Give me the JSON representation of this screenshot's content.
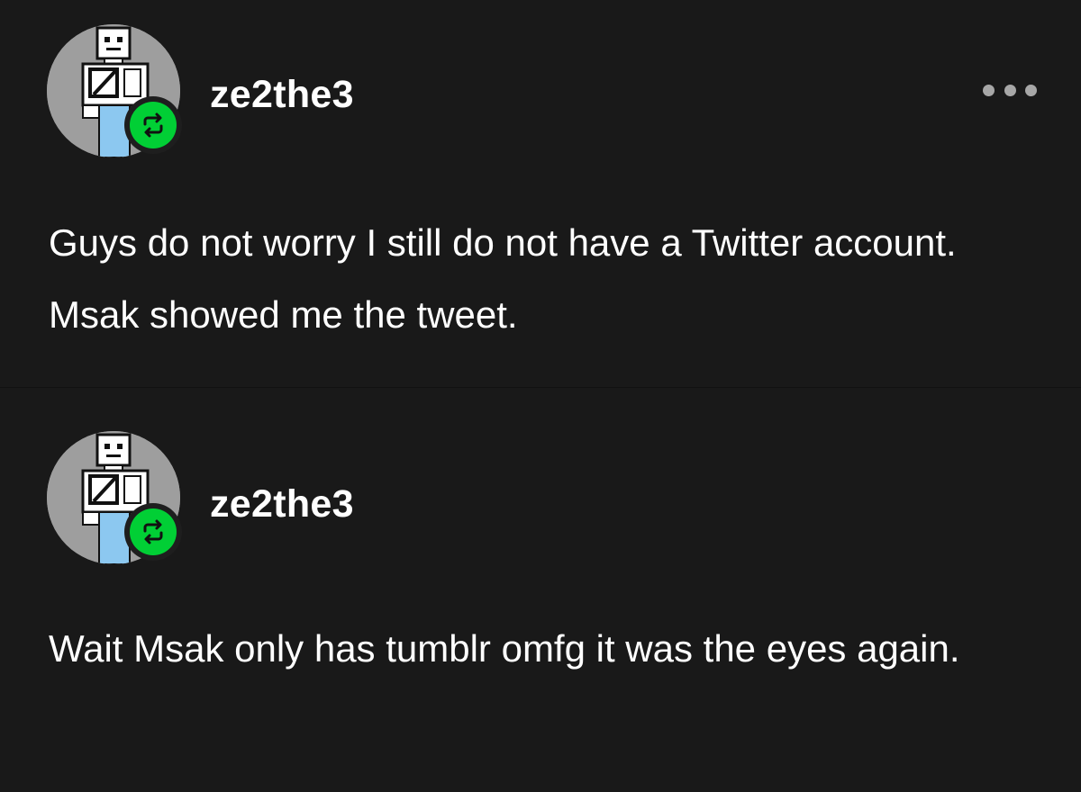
{
  "posts": [
    {
      "username": "ze2the3",
      "body": "Guys do not worry I still do not have a Twitter account. Msak showed me the tweet.",
      "has_more_menu": true,
      "avatar_icon": "pixel-robot-avatar",
      "badge_icon": "reblog-icon"
    },
    {
      "username": "ze2the3",
      "body": "Wait Msak only has tumblr omfg it was the eyes again.",
      "has_more_menu": false,
      "avatar_icon": "pixel-robot-avatar",
      "badge_icon": "reblog-icon"
    }
  ],
  "colors": {
    "background": "#191919",
    "text": "#ffffff",
    "reblog_green": "#01cf35",
    "menu_dots": "#a7a7a7",
    "avatar_gray": "#9e9e9e",
    "avatar_blue": "#8cc8f0"
  }
}
